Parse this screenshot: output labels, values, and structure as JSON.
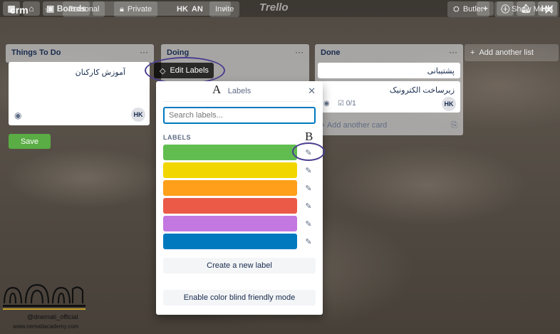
{
  "topbar": {
    "boards_label": "Boards",
    "logo_text": "Trello",
    "user_initials": "HK"
  },
  "board": {
    "title": "crm",
    "visibility_personal": "Personal",
    "visibility_private": "Private",
    "member_hk": "HK",
    "member_an": "AN",
    "invite_label": "Invite",
    "butler_label": "Butler",
    "show_menu_label": "Show Menu"
  },
  "lists": [
    {
      "title": "Things To Do"
    },
    {
      "title": "Doing"
    },
    {
      "title": "Done",
      "cards": [
        {
          "text": "پشتیبانی"
        },
        {
          "text": "زیرساخت الکترونیک",
          "checklist": "0/1",
          "member": "HK"
        }
      ],
      "add_card_label": "Add another card"
    }
  ],
  "add_list_label": "Add another list",
  "edit_card": {
    "text": "آموزش کارکنان",
    "member": "HK",
    "save_label": "Save"
  },
  "edit_labels_label": "Edit Labels",
  "labels_popover": {
    "title": "Labels",
    "search_placeholder": "Search labels...",
    "section_label": "LABELS",
    "labels": [
      {
        "color": "#61bd4f"
      },
      {
        "color": "#f2d600"
      },
      {
        "color": "#ff9f1a"
      },
      {
        "color": "#eb5a46"
      },
      {
        "color": "#c377e0"
      },
      {
        "color": "#0079bf"
      }
    ],
    "create_label": "Create a new label",
    "color_blind_label": "Enable color blind friendly mode"
  },
  "annotations": {
    "a": "A",
    "b": "B"
  },
  "watermark": {
    "instagram": "@dnemati_official",
    "website": "www.nematiacademy.com"
  }
}
